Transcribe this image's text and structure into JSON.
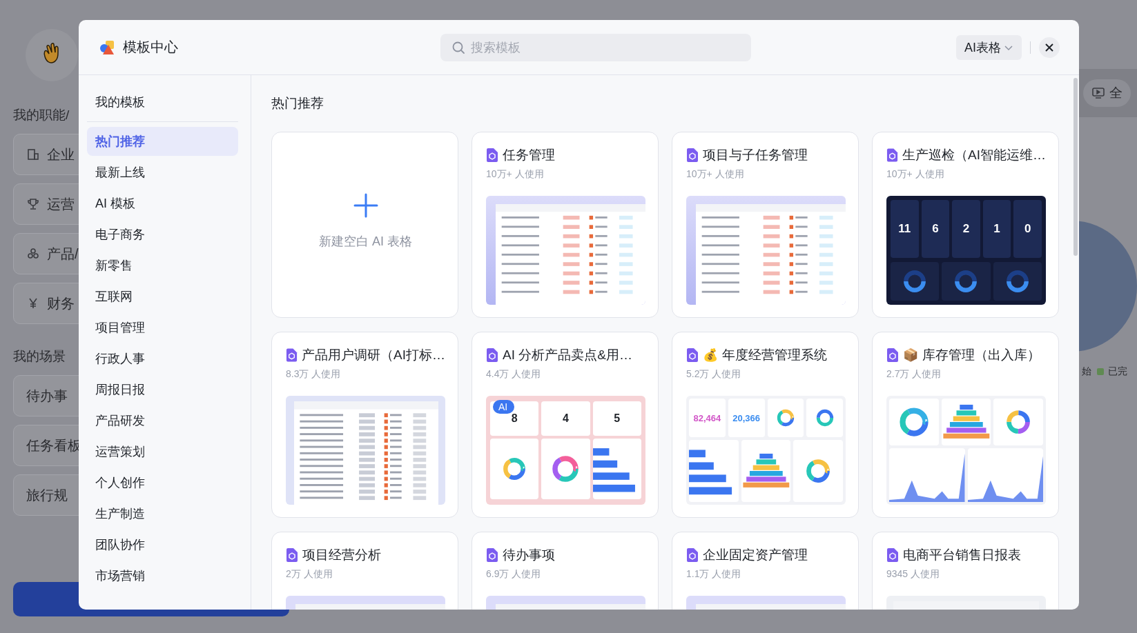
{
  "background": {
    "sections": [
      {
        "heading": "我的职能/",
        "items": [
          {
            "kind": "building",
            "label": "企业"
          },
          {
            "kind": "trophy",
            "label": "运营"
          },
          {
            "kind": "shapes",
            "label": "产品/"
          },
          {
            "kind": "yen",
            "label": "财务"
          }
        ]
      },
      {
        "heading": "我的场景",
        "items": [
          {
            "kind": "plain",
            "label": "待办事"
          },
          {
            "kind": "plain",
            "label": "任务看板"
          },
          {
            "kind": "plain",
            "label": "旅行规"
          }
        ]
      }
    ],
    "right_button": "全",
    "legend": [
      {
        "label": "始"
      },
      {
        "label": "已完",
        "color": "#5f8a52"
      }
    ]
  },
  "modal": {
    "title": "模板中心",
    "search": {
      "placeholder": "搜索模板"
    },
    "type_select": "AI表格",
    "sidebar": {
      "mine": "我的模板",
      "categories": [
        {
          "label": "热门推荐",
          "selected": true
        },
        {
          "label": "最新上线",
          "selected": false
        },
        {
          "label": "AI 模板",
          "selected": false
        },
        {
          "label": "电子商务",
          "selected": false
        },
        {
          "label": "新零售",
          "selected": false
        },
        {
          "label": "互联网",
          "selected": false
        },
        {
          "label": "项目管理",
          "selected": false
        },
        {
          "label": "行政人事",
          "selected": false
        },
        {
          "label": "周报日报",
          "selected": false
        },
        {
          "label": "产品研发",
          "selected": false
        },
        {
          "label": "运营策划",
          "selected": false
        },
        {
          "label": "个人创作",
          "selected": false
        },
        {
          "label": "生产制造",
          "selected": false
        },
        {
          "label": "团队协作",
          "selected": false
        },
        {
          "label": "市场营销",
          "selected": false
        }
      ]
    },
    "section_title": "热门推荐",
    "cards": [
      {
        "kind": "blank",
        "label": "新建空白 AI 表格"
      },
      {
        "kind": "template",
        "title": "任务管理",
        "usage": "10万+ 人使用",
        "preview": {
          "kind": "table"
        }
      },
      {
        "kind": "template",
        "title": "项目与子任务管理",
        "usage": "10万+ 人使用",
        "preview": {
          "kind": "table"
        }
      },
      {
        "kind": "template",
        "title": "生产巡检（AI智能运维…",
        "usage": "10万+ 人使用",
        "preview": {
          "kind": "dark-dashboard",
          "figures": [
            "11",
            "6",
            "2",
            "1",
            "0"
          ]
        }
      },
      {
        "kind": "template",
        "title": "产品用户调研（AI打标…",
        "usage": "8.3万 人使用",
        "preview": {
          "kind": "sheet"
        }
      },
      {
        "kind": "template",
        "title": "AI 分析产品卖点&用…",
        "usage": "4.4万 人使用",
        "preview": {
          "kind": "ai-stats",
          "badge": "AI",
          "figures": [
            "8",
            "4",
            "5"
          ]
        }
      },
      {
        "kind": "template",
        "title": "年度经营管理系统",
        "emoji": "💰",
        "usage": "5.2万 人使用",
        "preview": {
          "kind": "light-dashboard",
          "figures": [
            "82,464",
            "20,366"
          ]
        }
      },
      {
        "kind": "template",
        "title": "库存管理（出入库）",
        "emoji": "📦",
        "usage": "2.7万 人使用",
        "preview": {
          "kind": "charts"
        }
      },
      {
        "kind": "template",
        "title": "项目经营分析",
        "usage": "2万 人使用",
        "preview": {
          "kind": "strip"
        }
      },
      {
        "kind": "template",
        "title": "待办事项",
        "usage": "6.9万 人使用",
        "preview": {
          "kind": "strip"
        }
      },
      {
        "kind": "template",
        "title": "企业固定资产管理",
        "usage": "1.1万 人使用",
        "preview": {
          "kind": "strip"
        }
      },
      {
        "kind": "template",
        "title": "电商平台销售日报表",
        "usage": "9345 人使用",
        "preview": {
          "kind": "strip-light"
        }
      }
    ]
  }
}
